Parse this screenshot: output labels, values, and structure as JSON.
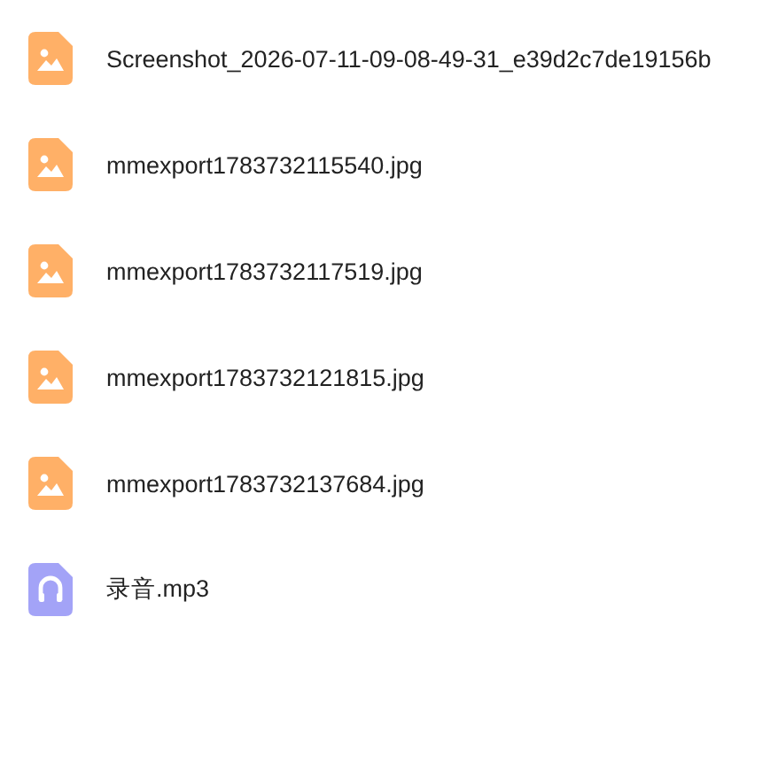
{
  "files": [
    {
      "name": "Screenshot_2026-07-11-09-08-49-31_e39d2c7de19156b",
      "kind": "image"
    },
    {
      "name": "mmexport1783732115540.jpg",
      "kind": "image"
    },
    {
      "name": "mmexport1783732117519.jpg",
      "kind": "image"
    },
    {
      "name": "mmexport1783732121815.jpg",
      "kind": "image"
    },
    {
      "name": "mmexport1783732137684.jpg",
      "kind": "image"
    },
    {
      "name": "录音.mp3",
      "kind": "audio"
    }
  ]
}
